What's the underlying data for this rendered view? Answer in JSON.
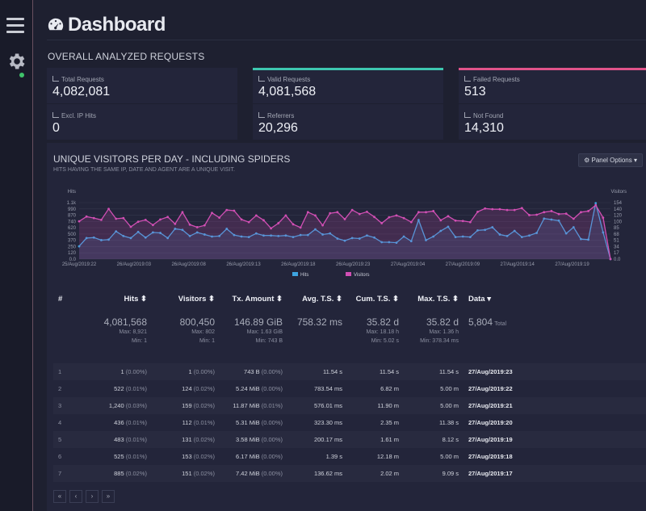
{
  "app": {
    "title": "Dashboard"
  },
  "overall": {
    "title": "OVERALL ANALYZED REQUESTS",
    "cards": [
      {
        "label": "Total Requests",
        "value": "4,082,081",
        "accent": ""
      },
      {
        "label": "Valid Requests",
        "value": "4,081,568",
        "accent": "#3ec7b0"
      },
      {
        "label": "Failed Requests",
        "value": "513",
        "accent": "#e0538a"
      },
      {
        "label": "Excl. IP Hits",
        "value": "0",
        "accent": ""
      },
      {
        "label": "Referrers",
        "value": "20,296",
        "accent": ""
      },
      {
        "label": "Not Found",
        "value": "14,310",
        "accent": ""
      }
    ]
  },
  "panel": {
    "title": "UNIQUE VISITORS PER DAY - INCLUDING SPIDERS",
    "subtitle": "HITS HAVING THE SAME IP, DATE AND AGENT ARE A UNIQUE VISIT.",
    "options_label": "Panel Options"
  },
  "chart_data": {
    "type": "line",
    "left_axis_label": "Hits",
    "right_axis_label": "Visitors",
    "left_ticks": [
      "1.1k",
      "990",
      "870",
      "740",
      "620",
      "500",
      "370",
      "250",
      "120",
      "0.0"
    ],
    "right_ticks": [
      "154",
      "140",
      "120",
      "100",
      "85",
      "68",
      "51",
      "34",
      "17",
      "0.0"
    ],
    "x_tick_labels": [
      "25/Aug/2019:22",
      "26/Aug/2019:03",
      "26/Aug/2019:08",
      "26/Aug/2019:13",
      "26/Aug/2019:18",
      "26/Aug/2019:23",
      "27/Aug/2019:04",
      "27/Aug/2019:09",
      "27/Aug/2019:14",
      "27/Aug/2019:19"
    ],
    "ylim_hits": [
      0,
      1100
    ],
    "ylim_visitors": [
      0,
      154
    ],
    "series": [
      {
        "name": "Hits",
        "color": "#3ea4e0",
        "values": [
          250,
          410,
          420,
          370,
          380,
          540,
          450,
          410,
          530,
          420,
          520,
          510,
          410,
          590,
          570,
          450,
          520,
          480,
          440,
          450,
          590,
          470,
          440,
          430,
          500,
          460,
          460,
          450,
          460,
          430,
          470,
          470,
          580,
          480,
          500,
          400,
          360,
          410,
          400,
          460,
          420,
          330,
          330,
          320,
          440,
          350,
          760,
          370,
          440,
          550,
          630,
          430,
          440,
          430,
          560,
          570,
          620,
          480,
          450,
          550,
          430,
          460,
          510,
          790,
          770,
          750,
          500,
          620,
          390,
          380,
          1090,
          520,
          0
        ]
      },
      {
        "name": "Visitors",
        "color": "#d14fb4",
        "values": [
          103,
          116,
          112,
          107,
          137,
          110,
          112,
          88,
          102,
          107,
          93,
          108,
          115,
          96,
          128,
          94,
          87,
          92,
          126,
          113,
          134,
          132,
          108,
          101,
          119,
          106,
          84,
          98,
          119,
          95,
          86,
          128,
          119,
          92,
          125,
          128,
          109,
          134,
          123,
          129,
          115,
          98,
          114,
          119,
          112,
          101,
          128,
          128,
          131,
          106,
          117,
          105,
          104,
          101,
          129,
          138,
          136,
          136,
          134,
          134,
          139,
          120,
          121,
          128,
          131,
          123,
          124,
          110,
          128,
          131,
          147,
          113,
          0
        ]
      }
    ]
  },
  "table": {
    "headers": [
      "#",
      "Hits",
      "Visitors",
      "Tx. Amount",
      "Avg. T.S.",
      "Cum. T.S.",
      "Max. T.S.",
      "Data"
    ],
    "summary": {
      "hits": "4,081,568",
      "hits_max": "Max: 8,921",
      "hits_min": "Min: 1",
      "visitors": "800,450",
      "visitors_max": "Max: 802",
      "visitors_min": "Min: 1",
      "tx": "146.89 GiB",
      "tx_max": "Max: 1.63 GiB",
      "tx_min": "Min: 743 B",
      "avg": "758.32 ms",
      "cum": "35.82 d",
      "cum_max": "Max: 18.18 h",
      "cum_min": "Min: 5.02 s",
      "max": "35.82 d",
      "max_max": "Max: 1.36 h",
      "max_min": "Min: 378.34 ms",
      "data_total": "5,804",
      "data_total_label": "Total"
    },
    "rows": [
      {
        "n": "1",
        "hits": "1",
        "hits_pct": "(0.00%)",
        "visitors": "1",
        "visitors_pct": "(0.00%)",
        "tx": "743 B",
        "tx_pct": "(0.00%)",
        "avg": "11.54 s",
        "cum": "11.54 s",
        "max": "11.54 s",
        "data": "27/Aug/2019:23"
      },
      {
        "n": "2",
        "hits": "522",
        "hits_pct": "(0.01%)",
        "visitors": "124",
        "visitors_pct": "(0.02%)",
        "tx": "5.24 MiB",
        "tx_pct": "(0.00%)",
        "avg": "783.54 ms",
        "cum": "6.82 m",
        "max": "5.00 m",
        "data": "27/Aug/2019:22"
      },
      {
        "n": "3",
        "hits": "1,240",
        "hits_pct": "(0.03%)",
        "visitors": "159",
        "visitors_pct": "(0.02%)",
        "tx": "11.87 MiB",
        "tx_pct": "(0.01%)",
        "avg": "576.01 ms",
        "cum": "11.90 m",
        "max": "5.00 m",
        "data": "27/Aug/2019:21"
      },
      {
        "n": "4",
        "hits": "436",
        "hits_pct": "(0.01%)",
        "visitors": "112",
        "visitors_pct": "(0.01%)",
        "tx": "5.31 MiB",
        "tx_pct": "(0.00%)",
        "avg": "323.30 ms",
        "cum": "2.35 m",
        "max": "11.38 s",
        "data": "27/Aug/2019:20"
      },
      {
        "n": "5",
        "hits": "483",
        "hits_pct": "(0.01%)",
        "visitors": "131",
        "visitors_pct": "(0.02%)",
        "tx": "3.58 MiB",
        "tx_pct": "(0.00%)",
        "avg": "200.17 ms",
        "cum": "1.61 m",
        "max": "8.12 s",
        "data": "27/Aug/2019:19"
      },
      {
        "n": "6",
        "hits": "525",
        "hits_pct": "(0.01%)",
        "visitors": "153",
        "visitors_pct": "(0.02%)",
        "tx": "6.17 MiB",
        "tx_pct": "(0.00%)",
        "avg": "1.39 s",
        "cum": "12.18 m",
        "max": "5.00 m",
        "data": "27/Aug/2019:18"
      },
      {
        "n": "7",
        "hits": "885",
        "hits_pct": "(0.02%)",
        "visitors": "151",
        "visitors_pct": "(0.02%)",
        "tx": "7.42 MiB",
        "tx_pct": "(0.00%)",
        "avg": "136.62 ms",
        "cum": "2.02 m",
        "max": "9.09 s",
        "data": "27/Aug/2019:17"
      }
    ]
  },
  "pager": [
    "«",
    "‹",
    "›",
    "»"
  ]
}
